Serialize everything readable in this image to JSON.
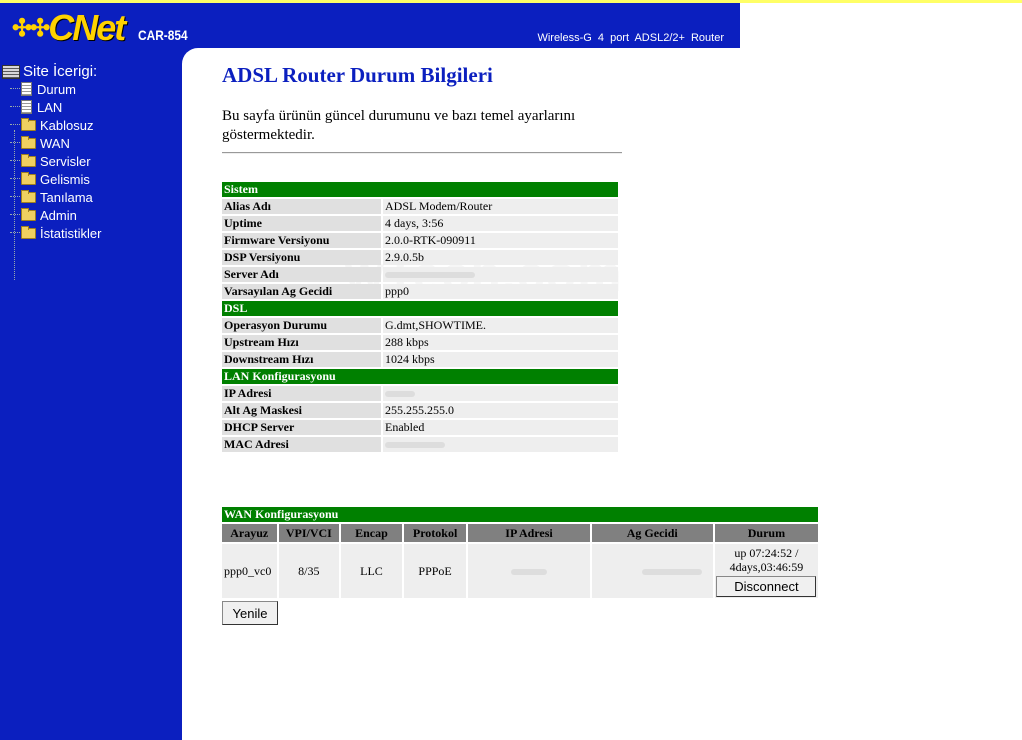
{
  "header": {
    "logo_mark": "✣✣",
    "brand": "CNet",
    "model": "CAR-854",
    "tagline": "Wireless-G 4 port ADSL2/2+ Router"
  },
  "sidebar": {
    "title": "Site İcerigi:",
    "items": [
      {
        "label": "Durum",
        "icon": "document-icon"
      },
      {
        "label": "LAN",
        "icon": "document-icon"
      },
      {
        "label": "Kablosuz",
        "icon": "folder-icon"
      },
      {
        "label": "WAN",
        "icon": "folder-icon"
      },
      {
        "label": "Servisler",
        "icon": "folder-icon"
      },
      {
        "label": "Gelismis",
        "icon": "folder-icon"
      },
      {
        "label": "Tanılama",
        "icon": "folder-icon"
      },
      {
        "label": "Admin",
        "icon": "folder-icon"
      },
      {
        "label": "İstatistikler",
        "icon": "folder-icon"
      }
    ]
  },
  "main": {
    "title": "ADSL Router Durum Bilgileri",
    "description": "Bu sayfa ürünün güncel durumunu ve bazı temel ayarlarını göstermektedir."
  },
  "system": {
    "header": "Sistem",
    "rows": [
      {
        "label": "Alias Adı",
        "value": "ADSL Modem/Router"
      },
      {
        "label": "Uptime",
        "value": "4 days, 3:56"
      },
      {
        "label": "Firmware Versiyonu",
        "value": "2.0.0-RTK-090911"
      },
      {
        "label": "DSP Versiyonu",
        "value": "2.9.0.5b"
      },
      {
        "label": "Server Adı",
        "value": ""
      },
      {
        "label": "Varsayılan Ag Gecidi",
        "value": "ppp0"
      }
    ]
  },
  "dsl": {
    "header": "DSL",
    "rows": [
      {
        "label": "Operasyon Durumu",
        "value": "G.dmt,SHOWTIME."
      },
      {
        "label": "Upstream Hızı",
        "value": "288 kbps"
      },
      {
        "label": "Downstream Hızı",
        "value": "1024 kbps"
      }
    ]
  },
  "lan": {
    "header": "LAN Konfigurasyonu",
    "rows": [
      {
        "label": "IP Adresi",
        "value": ""
      },
      {
        "label": "Alt Ag Maskesi",
        "value": "255.255.255.0"
      },
      {
        "label": "DHCP Server",
        "value": "Enabled"
      },
      {
        "label": "MAC Adresi",
        "value": ""
      }
    ]
  },
  "wan": {
    "header": "WAN Konfigurasyonu",
    "columns": [
      "Arayuz",
      "VPI/VCI",
      "Encap",
      "Protokol",
      "IP Adresi",
      "Ag Gecidi",
      "Durum"
    ],
    "row": {
      "interface": "ppp0_vc0",
      "vpi_vci": "8/35",
      "encap": "LLC",
      "protocol": "PPPoE",
      "ip": "",
      "gateway": "",
      "status": "up 07:24:52 / 4days,03:46:59",
      "disconnect_label": "Disconnect"
    }
  },
  "buttons": {
    "refresh": "Yenile"
  },
  "watermark": "wTech.com"
}
